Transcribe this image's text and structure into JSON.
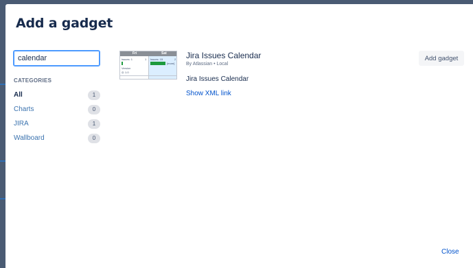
{
  "dialog": {
    "title": "Add a gadget",
    "close_label": "Close"
  },
  "search": {
    "value": "calendar"
  },
  "categories": {
    "heading": "CATEGORIES",
    "items": [
      {
        "label": "All",
        "count": "1",
        "active": true
      },
      {
        "label": "Charts",
        "count": "0",
        "active": false
      },
      {
        "label": "JIRA",
        "count": "1",
        "active": false
      },
      {
        "label": "Wallboard",
        "count": "0",
        "active": false
      }
    ]
  },
  "gadget": {
    "name": "Jira Issues Calendar",
    "byline": "By Atlassian • Local",
    "description": "Jira Issues Calendar",
    "xml_link": "Show XML link",
    "add_label": "Add gadget",
    "thumbnail": {
      "day1": "Fri",
      "day2": "Sat",
      "issues1": "Issues: 1",
      "issues2": "Issues: 15",
      "num1": "1",
      "num2": "2",
      "more": "[more]",
      "version": "Version",
      "version_num": "1.0"
    }
  },
  "colors": {
    "accent": "#0052cc",
    "title": "#172b4d",
    "focus": "#4c9aff"
  }
}
